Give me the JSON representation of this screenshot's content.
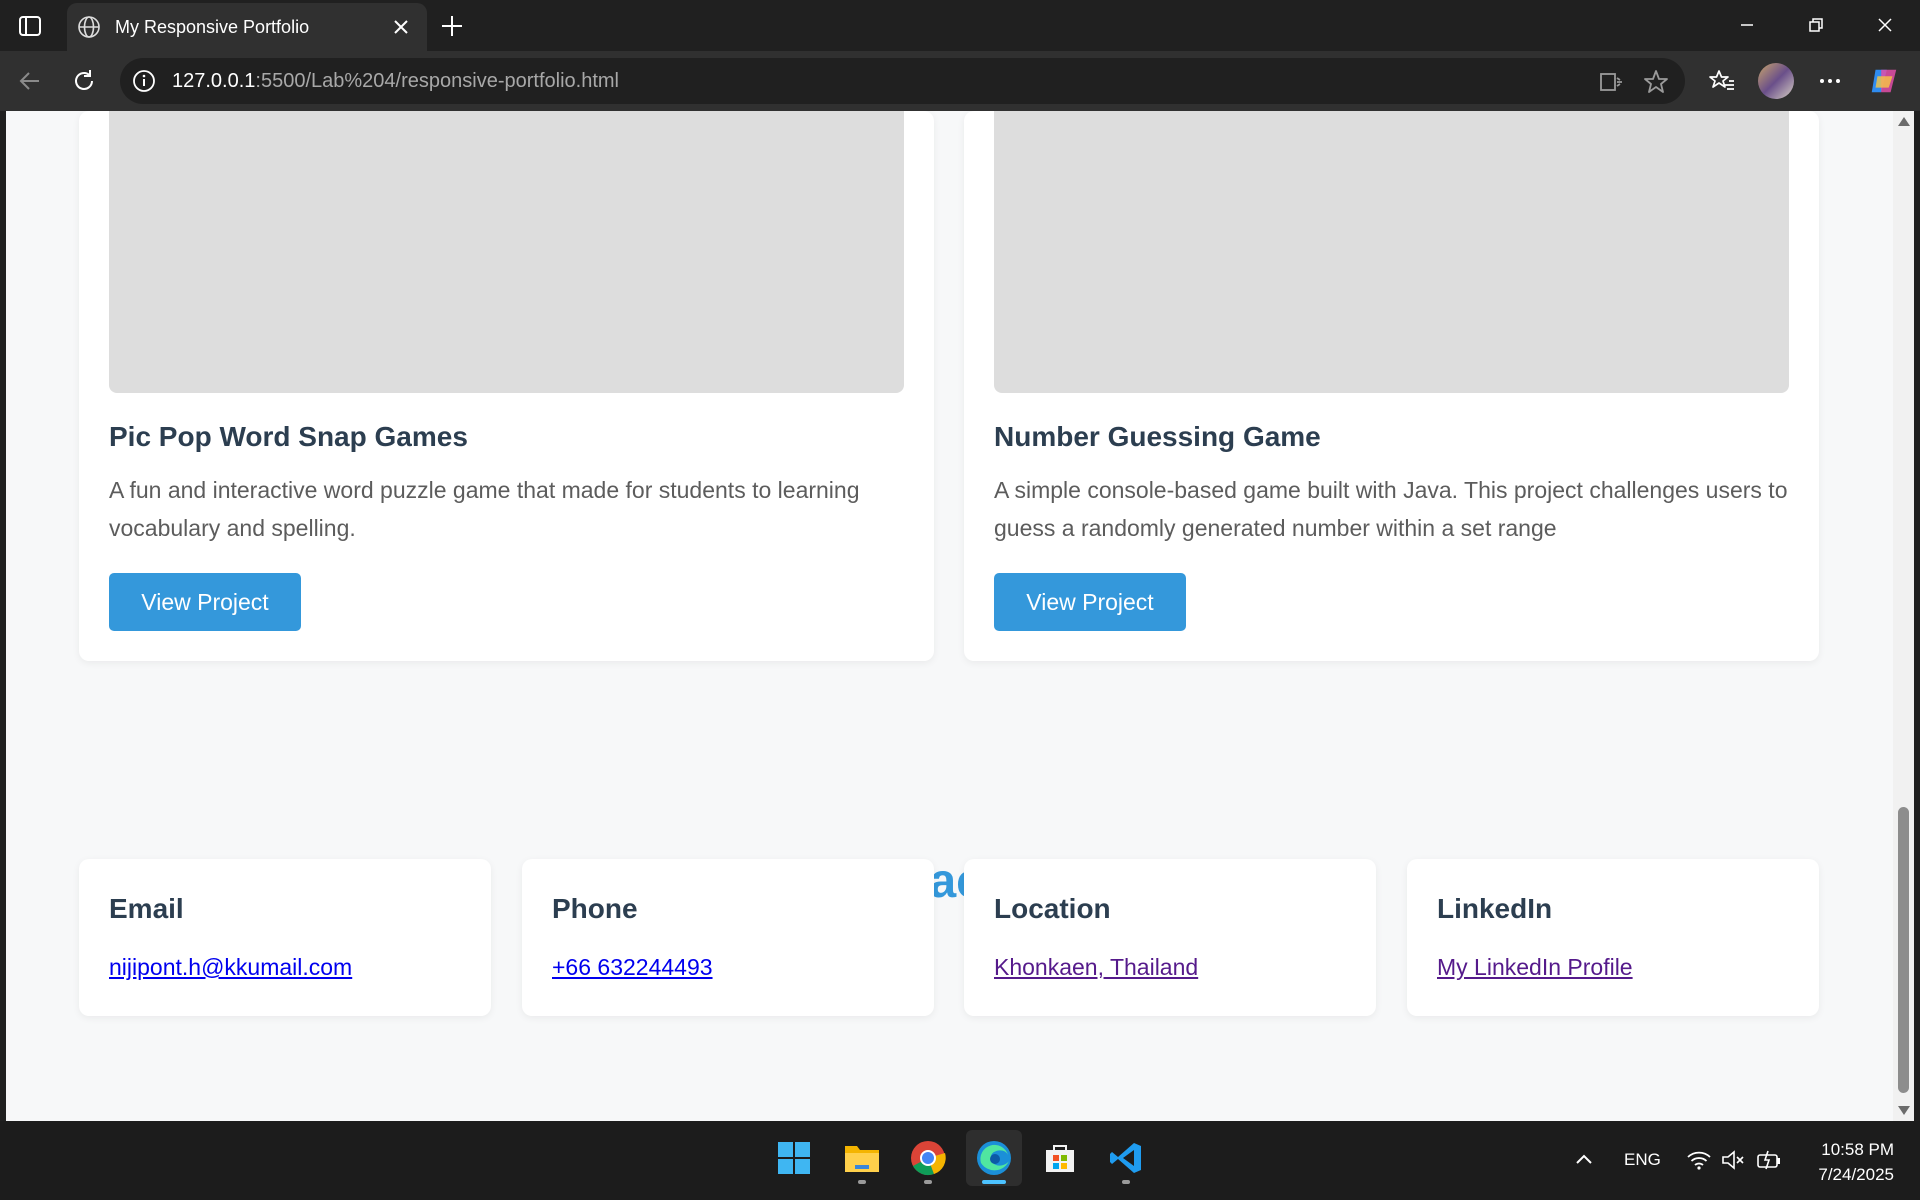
{
  "browser": {
    "tab_title": "My Responsive Portfolio",
    "url_host": "127.0.0.1",
    "url_rest": ":5500/Lab%204/responsive-portfolio.html"
  },
  "projects": [
    {
      "title": "Pic Pop Word Snap Games",
      "description": "A fun and interactive word puzzle game that made for students to learning vocabulary and spelling.",
      "button": "View Project"
    },
    {
      "title": "Number Guessing Game",
      "description": "A simple console-based game built with Java. This project challenges users to guess a randomly generated number within a set range",
      "button": "View Project"
    }
  ],
  "contact": {
    "heading": "Contact Me",
    "items": [
      {
        "title": "Email",
        "link": "nijipont.h@kkumail.com",
        "link_color": "#0000ee"
      },
      {
        "title": "Phone",
        "link": "+66 632244493",
        "link_color": "#0000ee"
      },
      {
        "title": "Location",
        "link": "Khonkaen, Thailand",
        "link_color": "#551a8b"
      },
      {
        "title": "LinkedIn",
        "link": "My LinkedIn Profile",
        "link_color": "#551a8b"
      }
    ]
  },
  "taskbar": {
    "apps": [
      "start-icon",
      "file-explorer-icon",
      "chrome-icon",
      "edge-icon",
      "microsoft-store-icon",
      "vscode-icon"
    ],
    "language": "ENG",
    "time": "10:58 PM",
    "date": "7/24/2025"
  },
  "colors": {
    "accent": "#3498db",
    "heading_text": "#2c3e50",
    "body_text": "#5c5c5c",
    "page_bg": "#f7f8f9"
  }
}
